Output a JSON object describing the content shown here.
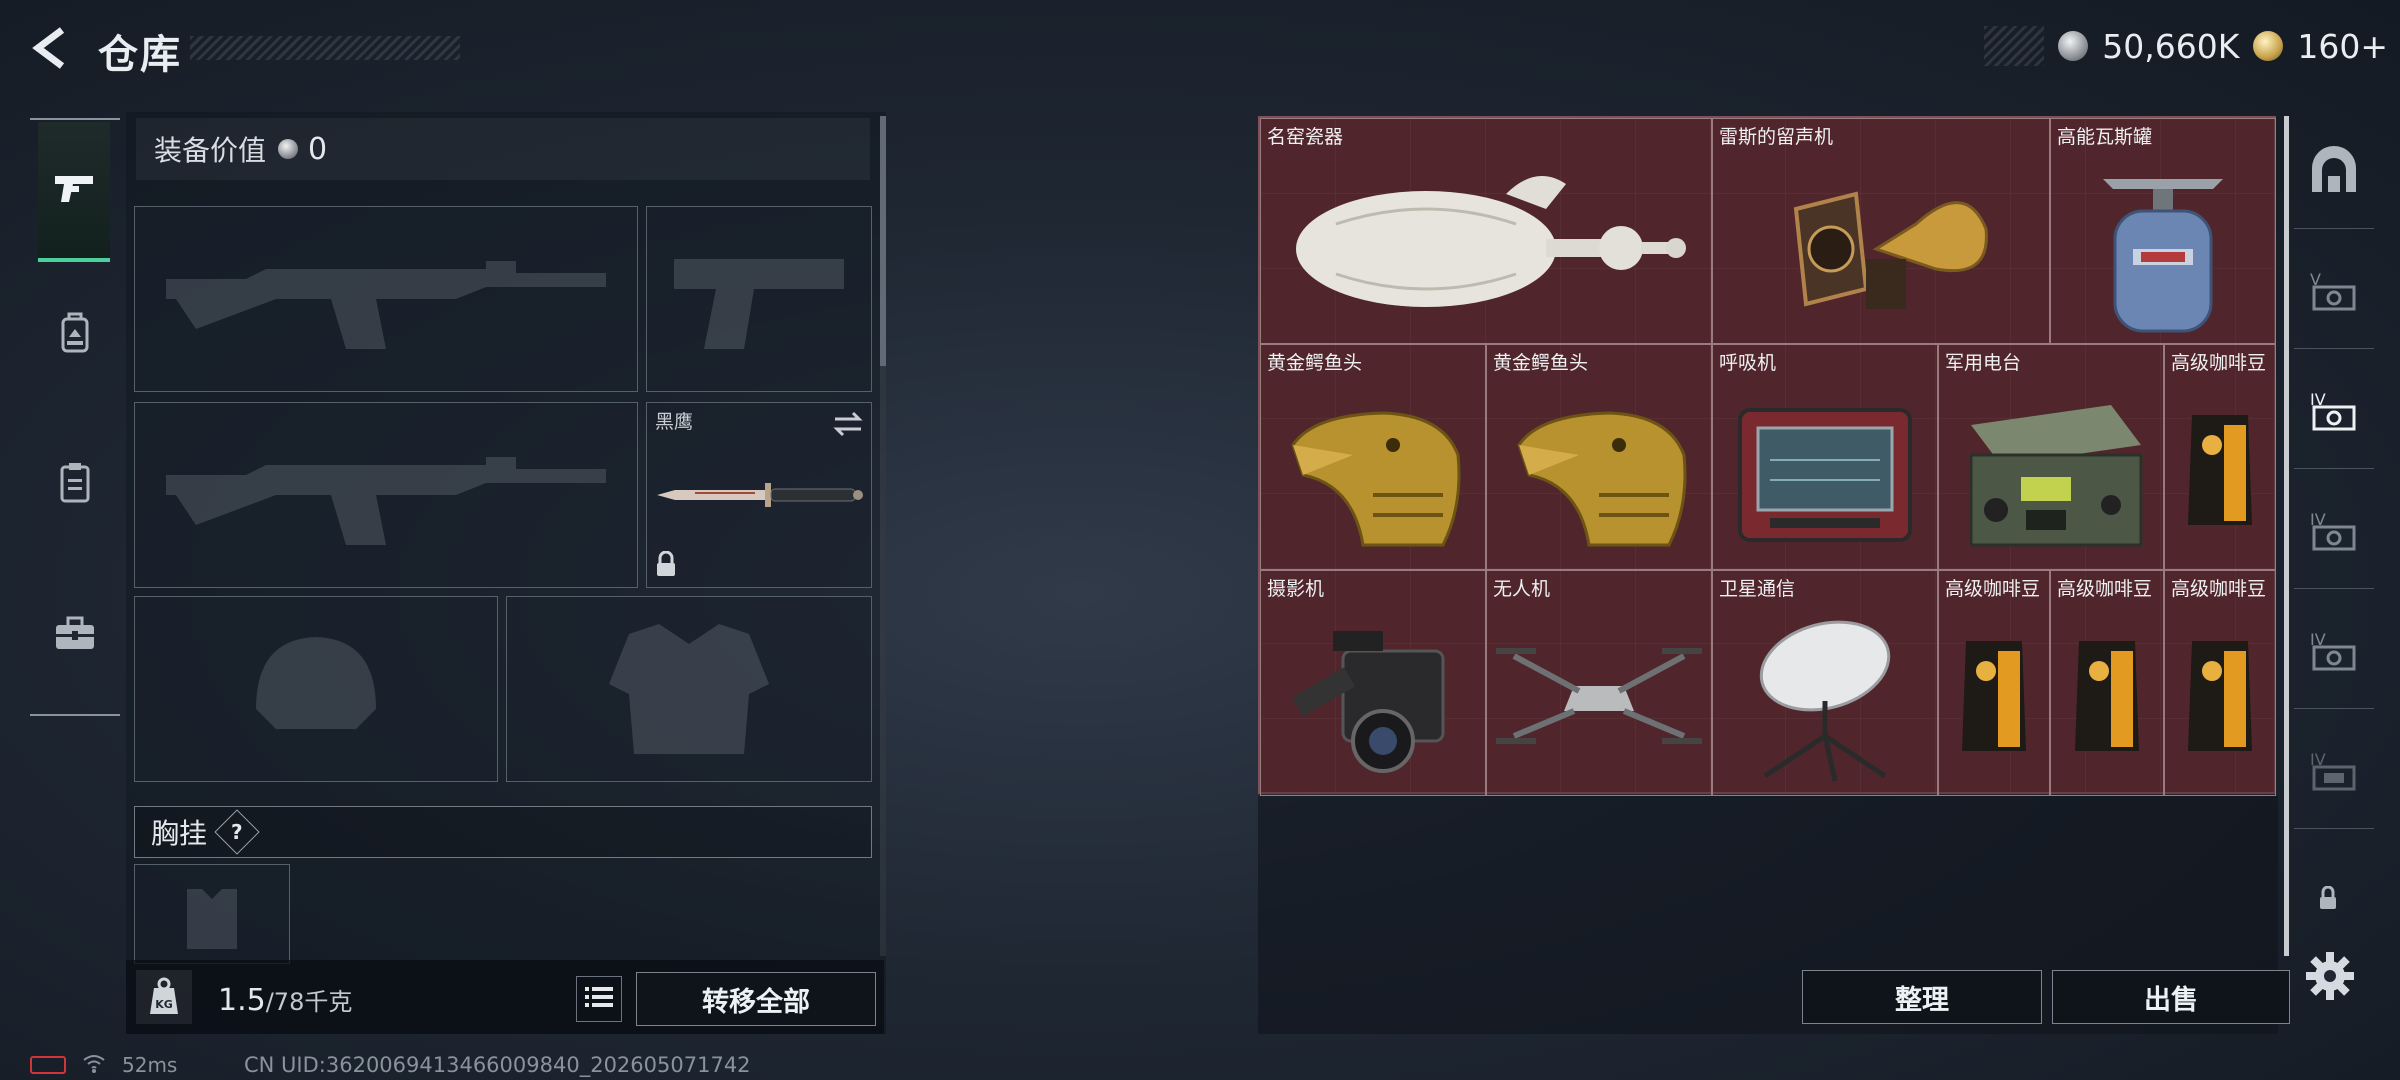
{
  "header": {
    "title": "仓库",
    "currency": [
      {
        "icon": "silver-coin-icon",
        "value": "50,660K"
      },
      {
        "icon": "gold-coin-icon",
        "value": "160+"
      }
    ]
  },
  "left_nav": {
    "items": [
      {
        "name": "weapons",
        "icon": "pistol-icon",
        "active": true
      },
      {
        "name": "backpack",
        "icon": "backpack-icon",
        "active": false
      },
      {
        "name": "clipboard",
        "icon": "clipboard-icon",
        "active": false
      },
      {
        "name": "toolbox",
        "icon": "toolbox-icon",
        "active": false
      }
    ]
  },
  "equipment": {
    "value_label": "装备价值",
    "value": "0",
    "slots": {
      "primary_weapon_1": "rifle",
      "sidearm": "pistol",
      "primary_weapon_2": "rifle",
      "melee": {
        "name": "黑鹰",
        "locked": true
      },
      "helmet": "helmet",
      "armor": "armor"
    },
    "chest_rig_label": "胸挂",
    "chest_rig_help": "?",
    "weight_current": "1.5",
    "weight_max": "/78千克",
    "transfer_all_label": "转移全部"
  },
  "inventory": {
    "background_color": "#572a30",
    "items": [
      {
        "name": "名窑瓷器",
        "icon": "porcelain-vase-icon"
      },
      {
        "name": "雷斯的留声机",
        "icon": "gramophone-icon"
      },
      {
        "name": "高能瓦斯罐",
        "icon": "gas-canister-icon"
      },
      {
        "name": "黄金鳄鱼头",
        "icon": "gold-crocodile-head-icon"
      },
      {
        "name": "黄金鳄鱼头",
        "icon": "gold-crocodile-head-icon"
      },
      {
        "name": "呼吸机",
        "icon": "ventilator-icon"
      },
      {
        "name": "军用电台",
        "icon": "military-radio-icon"
      },
      {
        "name": "高级咖啡豆",
        "icon": "coffee-bag-icon"
      },
      {
        "name": "摄影机",
        "icon": "video-camera-icon"
      },
      {
        "name": "无人机",
        "icon": "drone-icon"
      },
      {
        "name": "卫星通信",
        "icon": "satellite-dish-icon"
      },
      {
        "name": "高级咖啡豆",
        "icon": "coffee-bag-icon"
      },
      {
        "name": "高级咖啡豆",
        "icon": "coffee-bag-icon"
      },
      {
        "name": "高级咖啡豆",
        "icon": "coffee-bag-icon"
      }
    ],
    "sort_label": "整理",
    "sell_label": "出售"
  },
  "right_tabs": [
    {
      "icon": "safehouse-icon"
    },
    {
      "icon": "storage-v-icon"
    },
    {
      "icon": "storage-iv-icon",
      "active": true
    },
    {
      "icon": "storage-iv-icon"
    },
    {
      "icon": "storage-iv-icon"
    },
    {
      "icon": "storage-iv-icon"
    }
  ],
  "status_bar": {
    "ping": "52ms",
    "uid": "CN UID:3620069413466009840_202605071742"
  }
}
